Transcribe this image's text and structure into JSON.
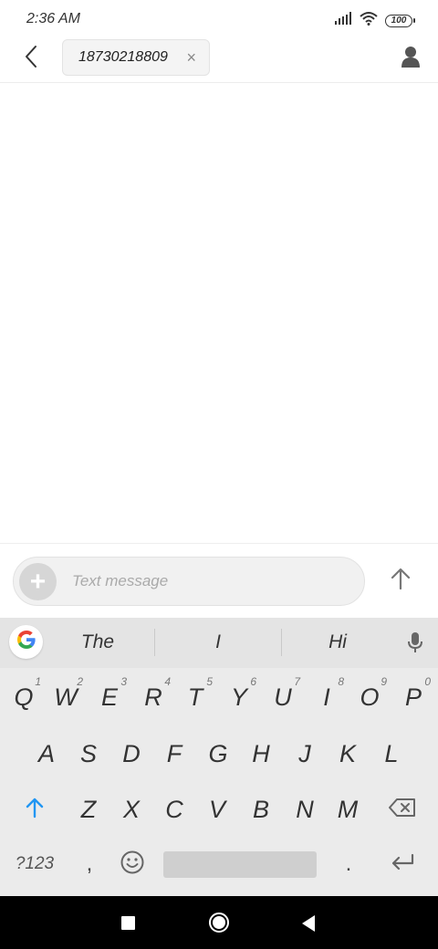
{
  "status_bar": {
    "time": "2:36 AM",
    "battery_level": "100",
    "icons": [
      "signal-icon",
      "wifi-icon",
      "battery-icon"
    ]
  },
  "header": {
    "recipient": "18730218809",
    "chip_close_symbol": "×",
    "icons": [
      "back-icon",
      "close-icon",
      "contact-icon"
    ]
  },
  "compose": {
    "add_symbol": "+",
    "placeholder": "Text message",
    "value": "",
    "icons": [
      "plus-icon",
      "send-arrow-icon"
    ]
  },
  "keyboard": {
    "suggestions": [
      "The",
      "I",
      "Hi"
    ],
    "row1": [
      {
        "key": "Q",
        "hint": "1"
      },
      {
        "key": "W",
        "hint": "2"
      },
      {
        "key": "E",
        "hint": "3"
      },
      {
        "key": "R",
        "hint": "4"
      },
      {
        "key": "T",
        "hint": "5"
      },
      {
        "key": "Y",
        "hint": "6"
      },
      {
        "key": "U",
        "hint": "7"
      },
      {
        "key": "I",
        "hint": "8"
      },
      {
        "key": "O",
        "hint": "9"
      },
      {
        "key": "P",
        "hint": "0"
      }
    ],
    "row2": [
      "A",
      "S",
      "D",
      "F",
      "G",
      "H",
      "J",
      "K",
      "L"
    ],
    "row3": [
      "Z",
      "X",
      "C",
      "V",
      "B",
      "N",
      "M"
    ],
    "symbols_label": "?123",
    "comma_label": ",",
    "period_label": ".",
    "icons": [
      "google-icon",
      "mic-icon",
      "shift-icon",
      "backspace-icon",
      "emoji-icon",
      "enter-icon"
    ]
  },
  "nav_bar": {
    "icons": [
      "recents-icon",
      "home-icon",
      "back-triangle-icon"
    ]
  },
  "colors": {
    "accent_blue": "#2196f3",
    "keyboard_bg": "#ebebeb",
    "suggest_bg": "#e4e4e4"
  }
}
